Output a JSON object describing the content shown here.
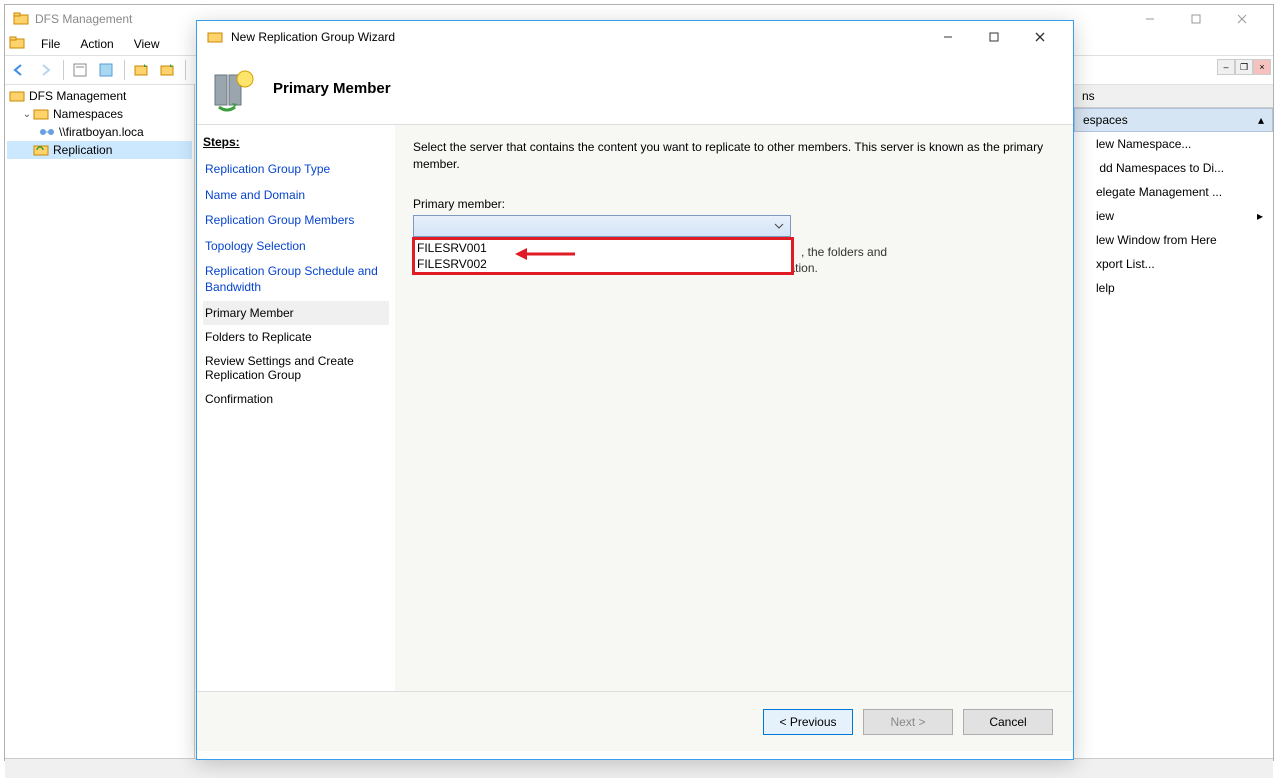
{
  "main_window": {
    "title": "DFS Management",
    "menu": {
      "file": "File",
      "action": "Action",
      "view": "View"
    },
    "tree": {
      "root": "DFS Management",
      "namespaces": "Namespaces",
      "namespace_item": "\\\\firatboyan.loca",
      "replication": "Replication"
    }
  },
  "actions": {
    "header": "ns",
    "section": "espaces",
    "items": {
      "new_namespace": "lew Namespace...",
      "add_namespaces": " dd Namespaces to Di...",
      "delegate": "elegate Management ...",
      "view": "iew",
      "new_window": "lew Window from Here",
      "export_list": "xport List...",
      "help": "lelp"
    }
  },
  "wizard": {
    "title": "New Replication Group Wizard",
    "page_title": "Primary Member",
    "steps_heading": "Steps:",
    "steps": {
      "s1": "Replication Group Type",
      "s2": "Name and Domain",
      "s3": "Replication Group Members",
      "s4": "Topology Selection",
      "s5": "Replication Group Schedule and Bandwidth",
      "s6": "Primary Member",
      "s7": "Folders to Replicate",
      "s8": "Review Settings and Create Replication Group",
      "s9": "Confirmation"
    },
    "desc": "Select the server that contains the content you want to replicate to other members. This server is known as the primary member.",
    "field_label": "Primary member:",
    "options": {
      "o1": "FILESRV001",
      "o2": "FILESRV002"
    },
    "behind_text1": ", the folders and",
    "behind_text2": "files on the primary member will be authoritative during initial replication.",
    "buttons": {
      "prev": "< Previous",
      "next": "Next >",
      "cancel": "Cancel"
    }
  }
}
